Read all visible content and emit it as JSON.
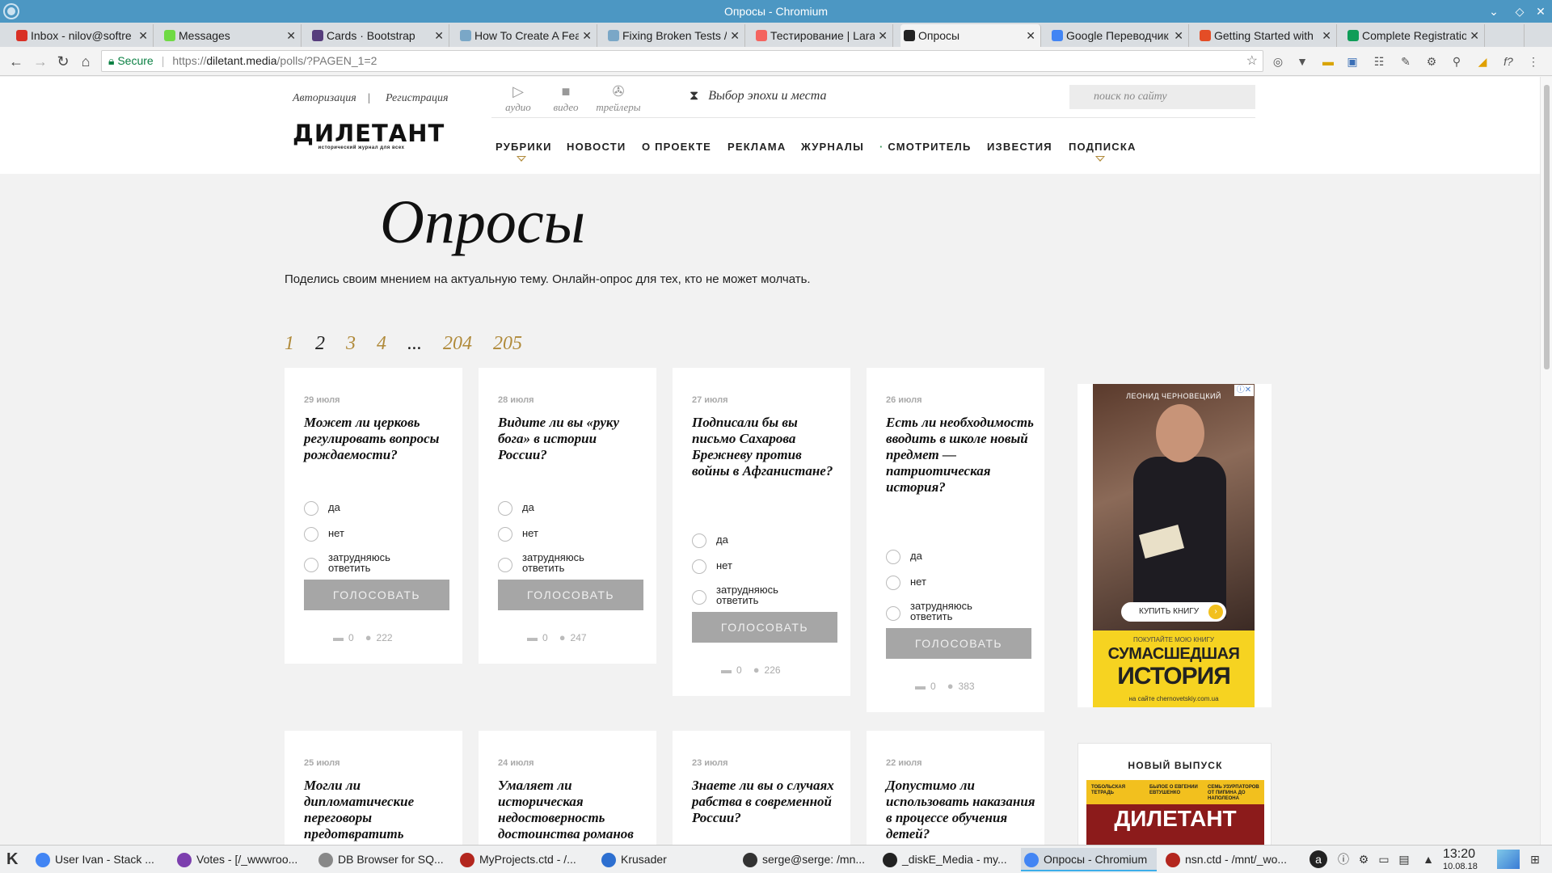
{
  "window": {
    "title": "Опросы - Chromium"
  },
  "tabs": [
    {
      "label": "Inbox - nilov@softre",
      "favicon_color": "#d93025"
    },
    {
      "label": "Messages",
      "favicon_color": "#6fda44"
    },
    {
      "label": "Cards · Bootstrap",
      "favicon_color": "#563d7c"
    },
    {
      "label": "How To Create A Fea",
      "favicon_color": "#7aa7c7"
    },
    {
      "label": "Fixing Broken Tests /",
      "favicon_color": "#7aa7c7"
    },
    {
      "label": "Тестирование | Lara",
      "favicon_color": "#f4645f"
    },
    {
      "label": "Опросы",
      "favicon_color": "#222222"
    },
    {
      "label": "Google Переводчик",
      "favicon_color": "#4285f4"
    },
    {
      "label": "Getting Started with",
      "favicon_color": "#e44d26"
    },
    {
      "label": "Complete Registratio",
      "favicon_color": "#0f9d58"
    }
  ],
  "toolbar": {
    "secure_label": "Secure",
    "url_scheme": "https://",
    "url_host": "diletant.media",
    "url_path": "/polls/?PAGEN_1=2"
  },
  "site": {
    "login": "Авторизация",
    "separator": "|",
    "register": "Регистрация",
    "media": [
      "аудио",
      "видео",
      "трейлеры"
    ],
    "epoch": "Выбор эпохи и места",
    "search_placeholder": "поиск по сайту",
    "logo_text": "ДИЛЕТАНТ",
    "logo_subtitle": "исторический журнал для всех",
    "nav": [
      "РУБРИКИ",
      "НОВОСТИ",
      "О ПРОЕКТЕ",
      "РЕКЛАМА",
      "ЖУРНАЛЫ",
      "СМОТРИТЕЛЬ",
      "ИЗВЕСТИЯ",
      "ПОДПИСКА"
    ]
  },
  "main": {
    "title": "Опросы",
    "description": "Поделись своим мнением на актуальную тему. Онлайн-опрос для тех, кто не может молчать.",
    "pagination": [
      "1",
      "2",
      "3",
      "4",
      "...",
      "204",
      "205"
    ],
    "current_page": "2"
  },
  "polls": [
    {
      "date": "29 июля",
      "question": "Может ли церковь регулировать вопросы рождаемости?",
      "options": [
        "да",
        "нет",
        "затрудняюсь ответить"
      ],
      "vote": "ГОЛОСОВАТЬ",
      "comments": "0",
      "voters": "222"
    },
    {
      "date": "28 июля",
      "question": "Видите ли вы «руку бога» в истории России?",
      "options": [
        "да",
        "нет",
        "затрудняюсь ответить"
      ],
      "vote": "ГОЛОСОВАТЬ",
      "comments": "0",
      "voters": "247"
    },
    {
      "date": "27 июля",
      "question": "Подписали бы вы письмо Сахарова Брежневу против войны в Афганистане?",
      "options": [
        "да",
        "нет",
        "затрудняюсь ответить"
      ],
      "vote": "ГОЛОСОВАТЬ",
      "comments": "0",
      "voters": "226"
    },
    {
      "date": "26 июля",
      "question": "Есть ли необходимость вводить в школе новый предмет — патриотическая история?",
      "options": [
        "да",
        "нет",
        "затрудняюсь ответить"
      ],
      "vote": "ГОЛОСОВАТЬ",
      "comments": "0",
      "voters": "383"
    },
    {
      "date": "25 июля",
      "question": "Могли ли дипломатические переговоры предотвратить"
    },
    {
      "date": "24 июля",
      "question": "Умаляет ли историческая недостоверность достоинства романов"
    },
    {
      "date": "23 июля",
      "question": "Знаете ли вы о случаях рабства в современной России?"
    },
    {
      "date": "22 июля",
      "question": "Допустимо ли использовать наказания в процессе обучения детей?"
    }
  ],
  "ad": {
    "name": "ЛЕОНИД ЧЕРНОВЕЦКИЙ",
    "buy": "КУПИТЬ КНИГУ",
    "promo": "ПОКУПАЙТЕ МОЮ КНИГУ",
    "title1": "СУМАСШЕДШАЯ",
    "title2": "ИСТОРИЯ",
    "site": "на сайте chernovetskiy.com.ua"
  },
  "new_issue": {
    "title": "НОВЫЙ ВЫПУСК",
    "cover_lines": [
      "ТОБОЛЬСКАЯ ТЕТРАДЬ",
      "БЫЛОЕ О ЕВГЕНИИ ЕВТУШЕНКО",
      "СЕМЬ УЗУРПАТОРОВ ОТ ПИПИНА ДО НАПОЛЕОНА"
    ],
    "cover_logo": "ДИЛЕТАНТ"
  },
  "taskbar": {
    "tasks": [
      {
        "label": "User Ivan - Stack ...",
        "color": "#4285f4"
      },
      {
        "label": "Votes - [/_wwwroo...",
        "color": "#7c3fae"
      },
      {
        "label": "DB Browser for SQ...",
        "color": "#888888"
      },
      {
        "label": "MyProjects.ctd - /...",
        "color": "#b3261e"
      },
      {
        "label": "Krusader",
        "color": "#2d6fd0"
      },
      {
        "label": "serge@serge: /mn...",
        "color": "#333333"
      },
      {
        "label": "_diskE_Media - my...",
        "color": "#222222"
      },
      {
        "label": "Опросы - Chromium",
        "color": "#4285f4"
      },
      {
        "label": "nsn.ctd - /mnt/_wo...",
        "color": "#b3261e"
      }
    ],
    "time": "13:20",
    "date": "10.08.18"
  }
}
